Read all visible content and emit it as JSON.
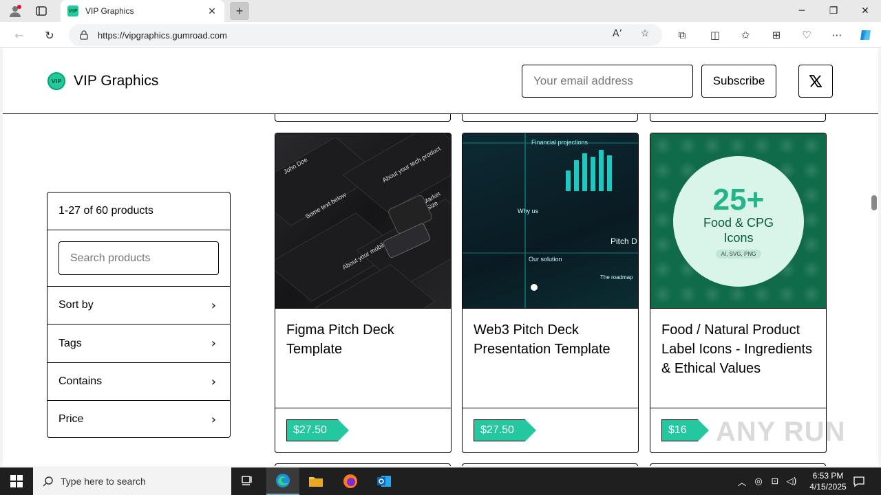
{
  "browser": {
    "tab_title": "VIP Graphics",
    "tab_favicon_text": "VIP",
    "url": "https://vipgraphics.gumroad.com"
  },
  "header": {
    "logo_text": "VIP",
    "brand": "VIP Graphics",
    "email_placeholder": "Your email address",
    "subscribe_label": "Subscribe"
  },
  "filter": {
    "count": "1-27 of 60 products",
    "search_placeholder": "Search products",
    "rows": [
      "Sort by",
      "Tags",
      "Contains",
      "Price"
    ]
  },
  "products": [
    {
      "title": "Figma Pitch Deck Template",
      "price": "$27.50",
      "thumb_texts": [
        "John Doe",
        "Some text below",
        "About your tech product",
        "About your mobile app product",
        "Market Size"
      ]
    },
    {
      "title": "Web3 Pitch Deck Presentation Template",
      "price": "$27.50",
      "thumb_texts": [
        "Financial projections",
        "Why us",
        "Our solution",
        "Pitch D",
        "The roadmap"
      ]
    },
    {
      "title": "Food / Natural Product Label Icons - Ingredients & Ethical Values",
      "price": "$16",
      "thumb_texts": [
        "25+",
        "Food & CPG",
        "Icons",
        "AI, SVG, PNG"
      ]
    }
  ],
  "watermark": "ANY RUN",
  "taskbar": {
    "search_placeholder": "Type here to search",
    "time": "6:53 PM",
    "date": "4/15/2025"
  },
  "colors": {
    "accent": "#23c8a0",
    "taskbar": "#1f1f1f"
  }
}
